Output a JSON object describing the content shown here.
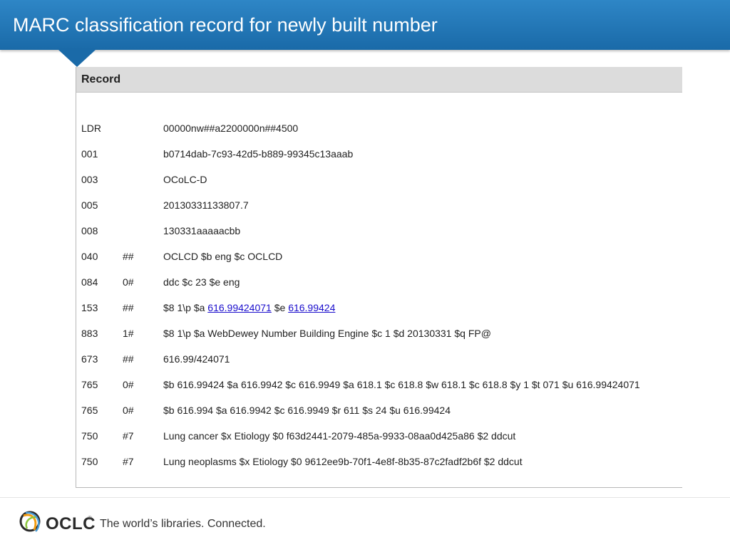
{
  "header": {
    "title": "MARC classification record for newly built number"
  },
  "record": {
    "heading": "Record",
    "fields": [
      {
        "tag": "LDR",
        "ind": "",
        "content": "00000nw##a2200000n##4500"
      },
      {
        "tag": "001",
        "ind": "",
        "content": "b0714dab-7c93-42d5-b889-99345c13aaab"
      },
      {
        "tag": "003",
        "ind": "",
        "content": "OCoLC-D"
      },
      {
        "tag": "005",
        "ind": "",
        "content": "20130331133807.7"
      },
      {
        "tag": "008",
        "ind": "",
        "content": "130331aaaaacbb"
      },
      {
        "tag": "040",
        "ind": "##",
        "content": "OCLCD $b eng $c OCLCD"
      },
      {
        "tag": "084",
        "ind": "0#",
        "content": "ddc $c 23 $e eng"
      },
      {
        "tag": "153",
        "ind": "##",
        "content_pre": "$8 1\\p $a",
        "link1": "616.99424071",
        "content_mid": "$e",
        "link2": "616.99424"
      },
      {
        "tag": "883",
        "ind": "1#",
        "content": "$8 1\\p $a WebDewey Number Building Engine $c 1 $d 20130331 $q FP@"
      },
      {
        "tag": "673",
        "ind": "##",
        "content": "616.99/424071"
      },
      {
        "tag": "765",
        "ind": "0#",
        "content": "$b 616.99424 $a 616.9942 $c 616.9949 $a 618.1 $c 618.8 $w 618.1 $c 618.8 $y 1 $t 071 $u 616.99424071"
      },
      {
        "tag": "765",
        "ind": "0#",
        "content": "$b 616.994 $a 616.9942 $c 616.9949 $r 611 $s 24 $u 616.99424"
      },
      {
        "tag": "750",
        "ind": "#7",
        "content": "Lung cancer $x Etiology $0 f63d2441-2079-485a-9933-08aa0d425a86 $2 ddcut"
      },
      {
        "tag": "750",
        "ind": "#7",
        "content": "Lung neoplasms $x Etiology $0 9612ee9b-70f1-4e8f-8b35-87c2fadf2b6f $2 ddcut"
      }
    ]
  },
  "footer": {
    "logo_text": "OCLC",
    "trademark": "®",
    "tagline": "The world’s libraries. Connected."
  }
}
